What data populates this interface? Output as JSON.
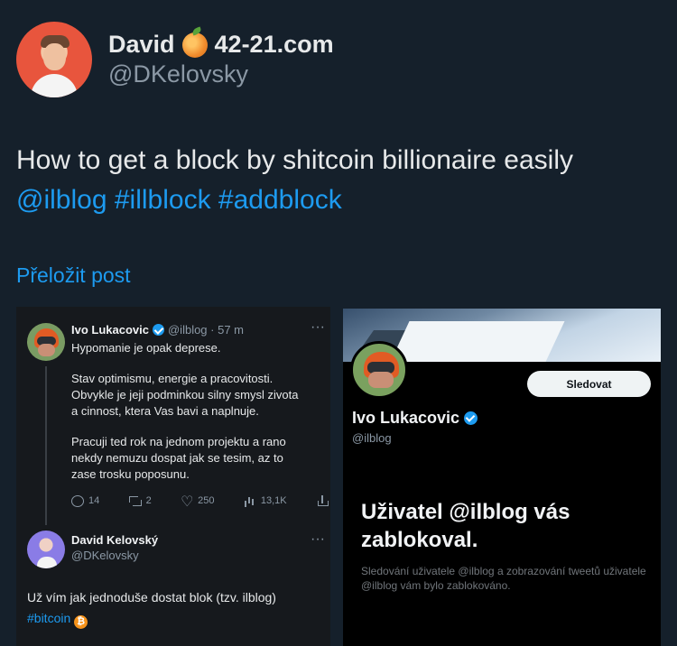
{
  "author": {
    "display_name": "David",
    "domain": "42-21.com",
    "handle": "@DKelovsky"
  },
  "tweet": {
    "text": "How to get a block by shitcoin billionaire easily",
    "mentions": [
      "@ilblog",
      "#illblock",
      "#addblock"
    ],
    "translate_label": "Přeložit post"
  },
  "left_screenshot": {
    "original_post": {
      "name": "Ivo Lukacovic",
      "meta": "@ilblog · 57 m",
      "paragraphs": [
        "Hypomanie je opak deprese.",
        "Stav optimismu, energie a pracovitosti.\nObvykle je jeji podminkou silny smysl zivota\na cinnost, ktera Vas bavi a naplnuje.",
        "Pracuji ted rok na jednom projektu a rano\nnekdy nemuzu dospat jak se tesim, az to\nzase trosku poposunu."
      ],
      "actions": {
        "replies": "14",
        "retweets": "2",
        "likes": "250",
        "views": "13,1K"
      }
    },
    "reply": {
      "name": "David Kelovský",
      "handle": "@DKelovsky",
      "text": "Už vím jak jednoduše dostat blok (tzv. ilblog)",
      "hashtag": "#bitcoin"
    }
  },
  "right_screenshot": {
    "follow_label": "Sledovat",
    "name": "Ivo Lukacovic",
    "handle": "@ilblog",
    "blocked_title": "Uživatel @ilblog vás zablokoval.",
    "blocked_text": "Sledování uživatele @ilblog a zobrazování tweetů uživatele @ilblog vám bylo zablokováno."
  },
  "colors": {
    "background": "#15202b",
    "accent": "#1d9bf0",
    "secondary_text": "#8b98a5"
  },
  "icons": [
    "peach-icon",
    "verified-icon",
    "reply-icon",
    "retweet-icon",
    "heart-icon",
    "views-icon",
    "share-icon",
    "bitcoin-icon"
  ]
}
